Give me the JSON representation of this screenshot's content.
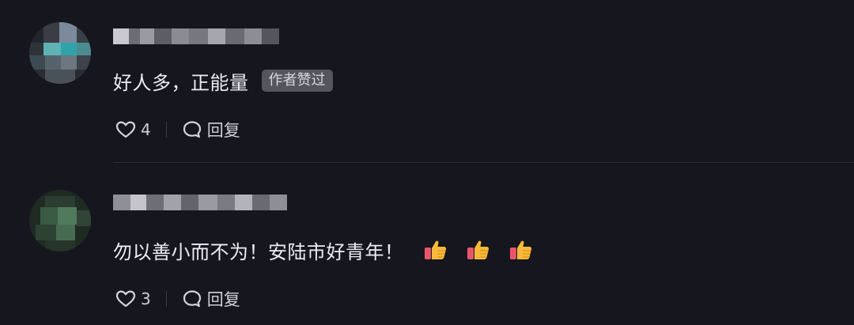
{
  "comments": [
    {
      "text": "好人多，正能量",
      "badge": "作者赞过",
      "likes": "4",
      "reply_label": "回复",
      "icons": [
        "heart-icon",
        "comment-bubble-icon"
      ]
    },
    {
      "text": "勿以善小而不为！安陆市好青年！",
      "emojis": [
        "thumbs-up-icon",
        "thumbs-up-icon",
        "thumbs-up-icon"
      ],
      "likes": "3",
      "reply_label": "回复",
      "icons": [
        "heart-icon",
        "comment-bubble-icon"
      ]
    }
  ],
  "colors": {
    "background": "#16161e",
    "text": "#ededf1",
    "badge_bg": "#55555f",
    "muted": "#cfcfd6"
  }
}
